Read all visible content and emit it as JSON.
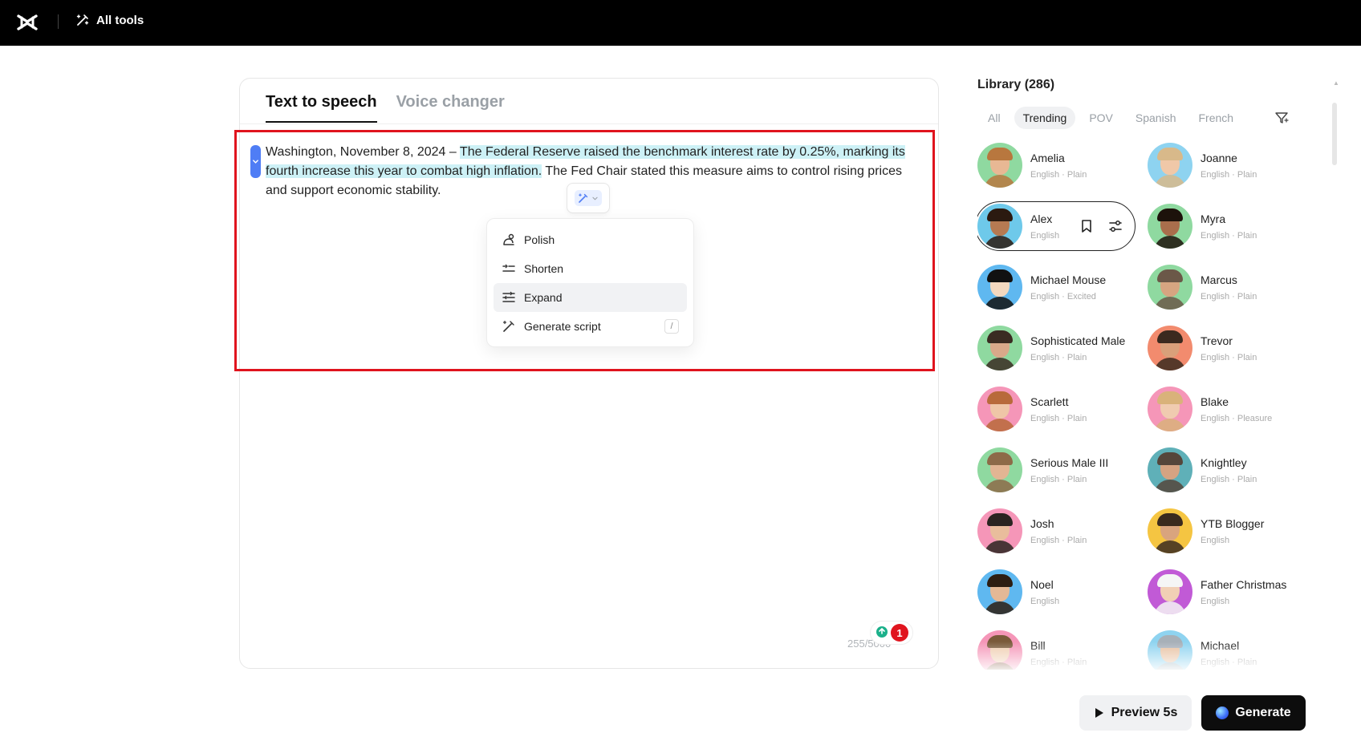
{
  "header": {
    "all_tools_label": "All tools"
  },
  "tabs": [
    {
      "label": "Text to speech"
    },
    {
      "label": "Voice changer"
    }
  ],
  "editor": {
    "text_before": "Washington, November 8, 2024 – ",
    "text_selected": "The Federal Reserve raised the benchmark interest rate by 0.25%, marking its fourth increase this year to combat high inflation.",
    "text_after": " The Fed Chair stated this measure aims to control rising prices and support economic stability.",
    "counter": "255/5000",
    "notification_count": "1"
  },
  "ai_menu": {
    "items": [
      {
        "label": "Polish",
        "icon": "polish-icon"
      },
      {
        "label": "Shorten",
        "icon": "shorten-icon"
      },
      {
        "label": "Expand",
        "icon": "expand-icon"
      },
      {
        "label": "Generate script",
        "icon": "generate-script-icon",
        "shortcut": "/"
      }
    ],
    "hovered": "Expand"
  },
  "library": {
    "title": "Library (286)",
    "filters": [
      "All",
      "Trending",
      "POV",
      "Spanish",
      "French"
    ],
    "active_filter": "Trending",
    "voices": [
      {
        "name": "Amelia",
        "meta": "English · Plain",
        "bg": "#8fd9a0",
        "skin": "#e8b894",
        "hair": "#b8773e"
      },
      {
        "name": "Joanne",
        "meta": "English · Plain",
        "bg": "#8ed3f0",
        "skin": "#f0c8a8",
        "hair": "#d8b98a"
      },
      {
        "name": "Alex",
        "meta": "English",
        "bg": "#6ec9ea",
        "skin": "#b67a52",
        "hair": "#2b1a10",
        "selected": true
      },
      {
        "name": "Myra",
        "meta": "English · Plain",
        "bg": "#8fd9a0",
        "skin": "#a96e4c",
        "hair": "#1d120b"
      },
      {
        "name": "Michael Mouse",
        "meta": "English · Excited",
        "bg": "#5fb8f0",
        "skin": "#f3d8bf",
        "hair": "#111111"
      },
      {
        "name": "Marcus",
        "meta": "English · Plain",
        "bg": "#8fd9a0",
        "skin": "#d6a581",
        "hair": "#6b5848"
      },
      {
        "name": "Sophisticated Male",
        "meta": "English · Plain",
        "bg": "#8fd9a0",
        "skin": "#d9a98a",
        "hair": "#3a2b22"
      },
      {
        "name": "Trevor",
        "meta": "English · Plain",
        "bg": "#f28b6e",
        "skin": "#d9a07a",
        "hair": "#3b2a1f"
      },
      {
        "name": "Scarlett",
        "meta": "English · Plain",
        "bg": "#f596b8",
        "skin": "#efc6a7",
        "hair": "#b86a3a"
      },
      {
        "name": "Blake",
        "meta": "English · Pleasure",
        "bg": "#f596b8",
        "skin": "#f0cbb0",
        "hair": "#d9b27a"
      },
      {
        "name": "Serious Male III",
        "meta": "English · Plain",
        "bg": "#8fd9a0",
        "skin": "#e2b593",
        "hair": "#8d6a48"
      },
      {
        "name": "Knightley",
        "meta": "English · Plain",
        "bg": "#5fb0b8",
        "skin": "#d5a382",
        "hair": "#55463b"
      },
      {
        "name": "Josh",
        "meta": "English · Plain",
        "bg": "#f596b8",
        "skin": "#e9bd9c",
        "hair": "#2a2420"
      },
      {
        "name": "YTB Blogger",
        "meta": "English",
        "bg": "#f5c542",
        "skin": "#d9a47e",
        "hair": "#3a2a1e"
      },
      {
        "name": "Noel",
        "meta": "English",
        "bg": "#5fb8f0",
        "skin": "#e4b896",
        "hair": "#2d1d12"
      },
      {
        "name": "Father Christmas",
        "meta": "English",
        "bg": "#c15ad6",
        "skin": "#f1cfb5",
        "hair": "#f5f5f5"
      },
      {
        "name": "Bill",
        "meta": "English · Plain",
        "bg": "#f596b8",
        "skin": "#efcdb0",
        "hair": "#7a5a3a"
      },
      {
        "name": "Michael",
        "meta": "English · Plain",
        "bg": "#8ed3f0",
        "skin": "#e7c0a0",
        "hair": "#a7b0b8"
      }
    ]
  },
  "buttons": {
    "preview_label": "Preview 5s",
    "generate_label": "Generate"
  }
}
